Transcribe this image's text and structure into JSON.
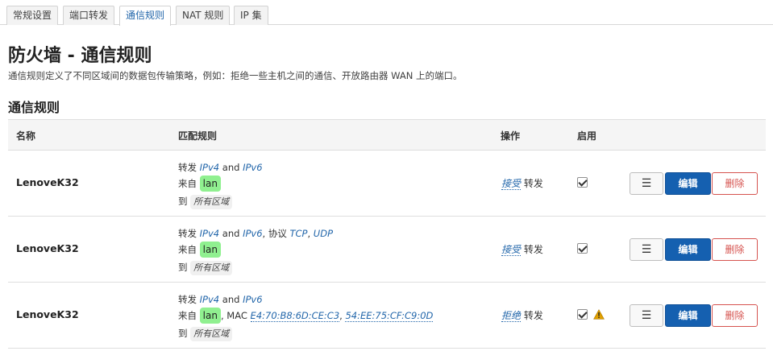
{
  "tabs": [
    {
      "label": "常规设置"
    },
    {
      "label": "端口转发"
    },
    {
      "label": "通信规则"
    },
    {
      "label": "NAT 规则"
    },
    {
      "label": "IP 集"
    }
  ],
  "page_title": "防火墙 - 通信规则",
  "page_desc": "通信规则定义了不同区域间的数据包传输策略，例如：拒绝一些主机之间的通信、开放路由器 WAN 上的端口。",
  "section_title": "通信规则",
  "columns": {
    "name": "名称",
    "match": "匹配规则",
    "action": "操作",
    "enable": "启用"
  },
  "common": {
    "forward": "转发",
    "ipv4": "IPv4",
    "and": "and",
    "ipv6": "IPv6",
    "from": "来自",
    "to": "到",
    "any_zone": "所有区域",
    "protocol": "协议",
    "tcp": "TCP",
    "udp": "UDP",
    "mac": "MAC",
    "forward_suffix": "转发",
    "menu_btn": "☰",
    "edit_btn": "编辑",
    "delete_btn": "删除"
  },
  "rules": [
    {
      "name": "LenoveK32",
      "zone": "lan",
      "action": "接受",
      "enabled": true
    },
    {
      "name": "LenoveK32",
      "zone": "lan",
      "action": "接受",
      "enabled": true
    },
    {
      "name": "LenoveK32",
      "zone": "lan",
      "mac1": "E4:70:B8:6D:CE:C3",
      "mac2": "54:EE:75:CF:C9:0D",
      "action": "拒绝",
      "enabled": true,
      "warning": true
    }
  ],
  "colors": {
    "accent": "#2266aa",
    "edit": "#1560b0",
    "delete": "#d6534f",
    "zone_lan": "#90f090",
    "warning": "#e0a000"
  }
}
